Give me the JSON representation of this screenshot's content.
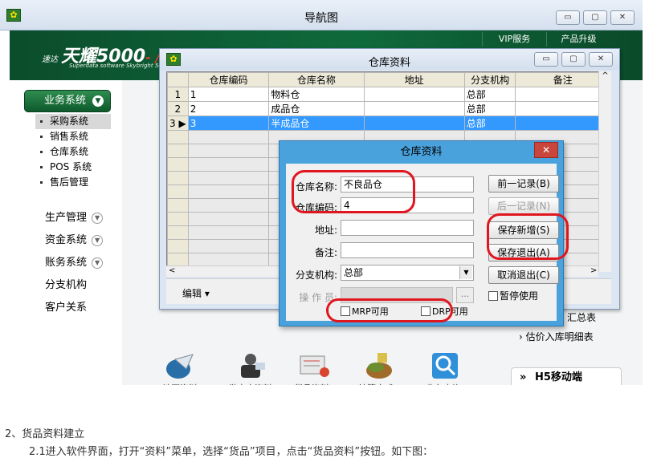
{
  "main_window": {
    "title": "导航图",
    "minimize_label": "▭",
    "maximize_label": "▢",
    "close_label": "✕"
  },
  "header": {
    "brand_prefix": "速达",
    "brand_name": "天耀5000",
    "brand_suffix": "- /",
    "brand_sub": "Superdata software Skybright 5000",
    "links": [
      "VIP服务",
      "产品升级"
    ]
  },
  "sidebar": {
    "business_label": "业务系统",
    "business_items": [
      "采购系统",
      "销售系统",
      "仓库系统",
      "POS 系统",
      "售后管理"
    ],
    "groups": [
      {
        "label": "生产管理",
        "has_chevron": true
      },
      {
        "label": "资金系统",
        "has_chevron": true
      },
      {
        "label": "账务系统",
        "has_chevron": true
      },
      {
        "label": "分支机构",
        "has_chevron": false
      },
      {
        "label": "客户关系",
        "has_chevron": false
      }
    ]
  },
  "right_panel": {
    "links": [
      "汇总表",
      "估价入库明细表"
    ],
    "h5_label": "H5移动端"
  },
  "tiles": [
    "地区资料",
    "供应商资料",
    "货品资料",
    "结算方式",
    "业务查询"
  ],
  "warehouse_window": {
    "title": "仓库资料",
    "columns": [
      "仓库编码",
      "仓库名称",
      "地址",
      "分支机构",
      "备注"
    ],
    "rows": [
      {
        "num": "1",
        "code": "1",
        "name": "物料仓",
        "address": "",
        "branch": "总部",
        "note": ""
      },
      {
        "num": "2",
        "code": "2",
        "name": "成品仓",
        "address": "",
        "branch": "总部",
        "note": ""
      },
      {
        "num": "3",
        "code": "3",
        "name": "半成品仓",
        "address": "",
        "branch": "总部",
        "note": "",
        "selected": true
      }
    ],
    "edit_menu_label": "编辑 ▾",
    "scroll_left": "<",
    "scroll_right": ">",
    "scroll_up": "^"
  },
  "edit_dialog": {
    "title": "仓库资料",
    "close_label": "✕",
    "fields": {
      "name_label": "仓库名称:",
      "name_value": "不良品仓",
      "code_label": "仓库编码:",
      "code_value": "4",
      "address_label": "地址:",
      "address_value": "",
      "note_label": "备注:",
      "note_value": "",
      "branch_label": "分支机构:",
      "branch_value": "总部",
      "operator_label": "操 作 员:",
      "operator_value": "",
      "ellipsis": "..."
    },
    "buttons": {
      "prev": "前一记录(B)",
      "next": "后一记录(N)",
      "save_new": "保存新增(S)",
      "save_exit": "保存退出(A)",
      "cancel_exit": "取消退出(C)"
    },
    "checkboxes": {
      "pause": "暂停使用",
      "mrp": "MRP可用",
      "drp": "DRP可用"
    }
  },
  "caption": {
    "line1": "2、货品资料建立",
    "line2": "2.1进入软件界面，打开“资料”菜单，选择“货品”项目，点击“货品资料”按钮。如下图："
  }
}
